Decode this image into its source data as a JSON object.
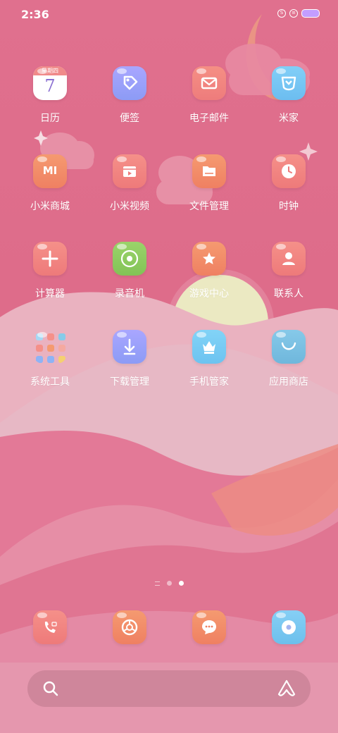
{
  "status_bar": {
    "time": "2:36",
    "icons": [
      "s-badge-icon",
      "sim-icon",
      "battery-icon"
    ]
  },
  "apps": [
    {
      "label": "日历",
      "icon": "calendar-icon",
      "weekday": "星期四",
      "day": "7"
    },
    {
      "label": "便签",
      "icon": "tag-icon"
    },
    {
      "label": "电子邮件",
      "icon": "mail-icon"
    },
    {
      "label": "米家",
      "icon": "mijia-icon"
    },
    {
      "label": "小米商城",
      "icon": "mi-store-icon",
      "logo": "MI"
    },
    {
      "label": "小米视频",
      "icon": "video-icon"
    },
    {
      "label": "文件管理",
      "icon": "folder-icon"
    },
    {
      "label": "时钟",
      "icon": "clock-icon"
    },
    {
      "label": "计算器",
      "icon": "calculator-icon"
    },
    {
      "label": "录音机",
      "icon": "recorder-icon"
    },
    {
      "label": "游戏中心",
      "icon": "star-icon"
    },
    {
      "label": "联系人",
      "icon": "contacts-icon"
    },
    {
      "label": "系统工具",
      "icon": "folder-grid-icon"
    },
    {
      "label": "下载管理",
      "icon": "download-icon"
    },
    {
      "label": "手机管家",
      "icon": "security-icon"
    },
    {
      "label": "应用商店",
      "icon": "app-store-icon"
    }
  ],
  "dock": [
    {
      "icon": "phone-icon"
    },
    {
      "icon": "browser-icon"
    },
    {
      "icon": "messages-icon"
    },
    {
      "icon": "music-icon"
    }
  ],
  "page_indicator": {
    "pages": 3,
    "active": 3
  },
  "search": {
    "icon": "search-icon",
    "assistant_icon": "assistant-icon"
  },
  "colors": {
    "background": "#e0708e",
    "label": "#ffffff",
    "sun": "#e8e5b8"
  }
}
